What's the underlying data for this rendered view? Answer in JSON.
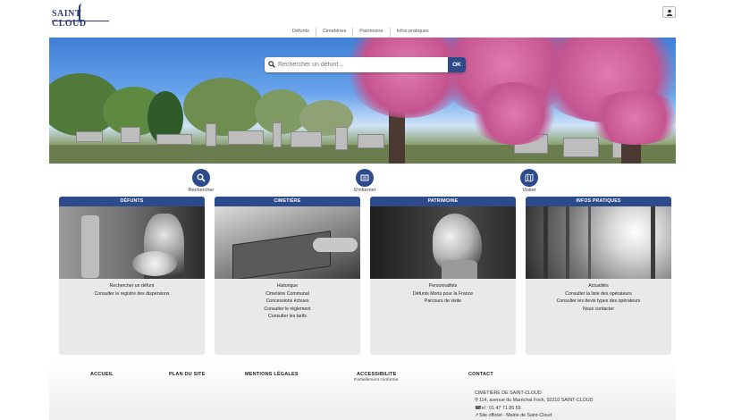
{
  "logo": {
    "text": "SAINT CLOUD"
  },
  "topnav": [
    "Défunts",
    "Cimetières",
    "Patrimoine",
    "Infos pratiques"
  ],
  "search": {
    "placeholder": "Rechercher un défunt...",
    "button": "OK"
  },
  "actions": [
    {
      "label": "Rechercher",
      "icon": "search-icon"
    },
    {
      "label": "S'informer",
      "icon": "newspaper-icon"
    },
    {
      "label": "Visiter",
      "icon": "map-icon"
    }
  ],
  "cards": [
    {
      "title": "DÉFUNTS",
      "links": [
        "Rechercher un défunt",
        "Consulter le registre des dispersions"
      ]
    },
    {
      "title": "CIMETIÈRE",
      "links": [
        "Historique",
        "Cimetière Communal",
        "Concessions échues",
        "Consulter le règlement",
        "Consulter les tarifs"
      ]
    },
    {
      "title": "PATRIMOINE",
      "links": [
        "Personnalités",
        "Défunts Morts pour la France",
        "Parcours de visite"
      ]
    },
    {
      "title": "INFOS PRATIQUES",
      "links": [
        "Actualités",
        "Consulter la liste des opérateurs",
        "Consulter les devis types des opérateurs",
        "Nous contacter"
      ]
    }
  ],
  "footer": {
    "cols": [
      "ACCUEIL",
      "PLAN DU SITE",
      "MENTIONS LÉGALES",
      "ACCESSIBILITE",
      "CONTACT"
    ],
    "accessibility_note": "Partiellement conforme",
    "contact": {
      "name": "CIMETIÈRE DE SAINT-CLOUD",
      "address": "114, avenue du Maréchal Foch, 92210 SAINT-CLOUD",
      "phone": "Tel : 01 47 71 85 59",
      "site": "Site officiel - Mairie de Saint-Cloud"
    }
  },
  "colors": {
    "primary": "#2d4b8c",
    "card_bg": "#e9e9e9"
  }
}
